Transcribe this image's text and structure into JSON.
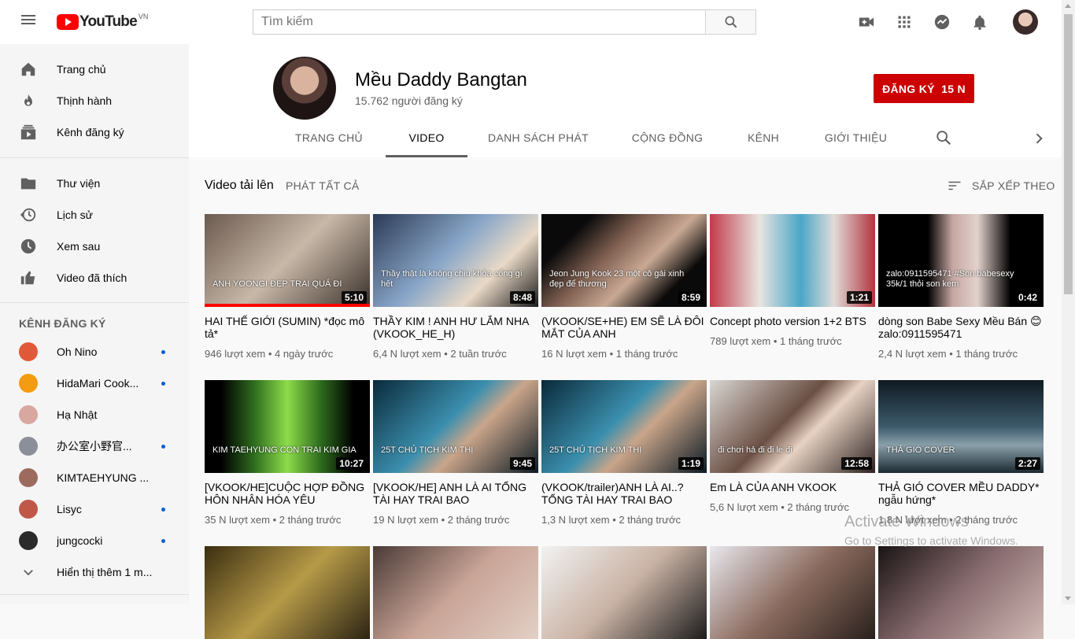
{
  "header": {
    "logo_text": "YouTube",
    "logo_country": "VN",
    "search_placeholder": "Tìm kiếm",
    "icons": [
      "menu-icon",
      "search-icon",
      "video-camera-icon",
      "apps-icon",
      "messages-icon",
      "bell-icon"
    ]
  },
  "sidebar": {
    "main_items": [
      {
        "label": "Trang chủ",
        "icon": "home-icon"
      },
      {
        "label": "Thịnh hành",
        "icon": "fire-icon"
      },
      {
        "label": "Kênh đăng ký",
        "icon": "subscriptions-icon"
      }
    ],
    "library_items": [
      {
        "label": "Thư viện",
        "icon": "folder-icon"
      },
      {
        "label": "Lịch sử",
        "icon": "history-icon"
      },
      {
        "label": "Xem sau",
        "icon": "clock-icon"
      },
      {
        "label": "Video đã thích",
        "icon": "thumbs-up-icon"
      }
    ],
    "subscriptions_heading": "KÊNH ĐĂNG KÝ",
    "subscriptions": [
      {
        "name": "Oh Nino",
        "new": true,
        "color": "#e05a3a"
      },
      {
        "name": "HidaMari Cook...",
        "new": true,
        "color": "#f39c12"
      },
      {
        "name": "Hạ Nhật",
        "new": false,
        "color": "#d8a7a0"
      },
      {
        "name": "办公室小野官...",
        "new": true,
        "color": "#8a8f99"
      },
      {
        "name": "KIMTAEHYUNG ...",
        "new": false,
        "color": "#9c6b5e"
      },
      {
        "name": "Lisyc",
        "new": true,
        "color": "#c0584a"
      },
      {
        "name": "jungcocki",
        "new": true,
        "color": "#2b2b2b"
      }
    ],
    "show_more": "Hiển thị thêm 1 m..."
  },
  "channel": {
    "name": "Mều Daddy Bangtan",
    "subscribers": "15.762 người đăng ký",
    "subscribe_label": "ĐĂNG KÝ",
    "subscribe_count": "15 N",
    "tabs": [
      "TRANG CHỦ",
      "VIDEO",
      "DANH SÁCH PHÁT",
      "CỘNG ĐỒNG",
      "KÊNH",
      "GIỚI THIỆU"
    ],
    "active_tab": "VIDEO"
  },
  "content": {
    "section_title": "Video tải lên",
    "play_all": "PHÁT TẤT CẢ",
    "sort_by": "SẮP XẾP THEO",
    "videos": [
      {
        "title": "HAI THẾ GIỚI (SUMIN) *đọc mô tả*",
        "views": "946 lượt xem",
        "age": "4 ngày trước",
        "duration": "5:10",
        "caption": "ANH YOONGI ĐẸP TRAI QUÁ ĐI",
        "progress": 1.0,
        "bg": "linear-gradient(135deg,#6b5a4e,#c8b8a8 50%,#3a302a)"
      },
      {
        "title": "THẦY KIM ! ANH HƯ LẮM NHA (VKOOK_HE_H)",
        "views": "6,4 N lượt xem",
        "age": "2 tuần trước",
        "duration": "8:48",
        "caption": "Thầy thật là không chịu khỏa cổng gì hết",
        "progress": 0,
        "bg": "linear-gradient(135deg,#2b3a55,#8aa7c9 45%,#e9d9c6 70%,#1a1a1a)"
      },
      {
        "title": "(VKOOK/SE+HE) EM SẼ LÀ ĐÔI MẮT CỦA ANH",
        "views": "16 N lượt xem",
        "age": "1 tháng trước",
        "duration": "8:59",
        "caption": "Jeon Jung Kook 23 một cô gái xinh đẹp để thương",
        "progress": 0,
        "bg": "linear-gradient(135deg,#0a0a0a 0 20%,#7a5b4d 40%,#c9a994 60%,#0a0a0a 80%)"
      },
      {
        "title": "Concept photo version 1+2 BTS",
        "views": "789 lượt xem",
        "age": "1 tháng trước",
        "duration": "1:21",
        "caption": "",
        "progress": 0,
        "bg": "linear-gradient(90deg,#c23a4a,#e9e4e0 30%,#4aa6c7 55%,#e0dcd8 75%,#b2343f)"
      },
      {
        "title": "dòng son Babe Sexy Mều Bán 😊zalo:0911595471",
        "views": "2,4 N lượt xem",
        "age": "1 tháng trước",
        "duration": "0:42",
        "caption": "zalo:0911595471 #Son babesexy 35k/1 thỏi son kem",
        "progress": 0,
        "bg": "linear-gradient(90deg,#000 0 30%,#c6a7a2 45%,#e3d2cc 60%,#000 80%)"
      },
      {
        "title": "[VKOOK/HE]CUỘC HỢP ĐỒNG HÔN NHÂN HÓA YÊU",
        "views": "35 N lượt xem",
        "age": "2 tháng trước",
        "duration": "10:27",
        "caption": "KIM TAEHYUNG CON TRAI KIM GIA",
        "progress": 0,
        "bg": "linear-gradient(90deg,#000 0 10%,#2e6d1e 30%,#8ddc4a 50%,#2e6d1e 70%,#000 90%)"
      },
      {
        "title": "[VKOOK/HE] ANH LÀ AI TỔNG TÀI HAY TRAI BAO",
        "views": "19 N lượt xem",
        "age": "2 tháng trước",
        "duration": "9:45",
        "caption": "25T CHỦ TỊCH KIM THỊ",
        "progress": 0,
        "bg": "linear-gradient(135deg,#0a2a3a,#3b8fae 45%,#c9a58a 60%,#0b1a24)"
      },
      {
        "title": "(VKOOK/trailer)ANH LÀ AI..? TỔNG TÀI HAY TRAI BAO",
        "views": "1,3 N lượt xem",
        "age": "2 tháng trước",
        "duration": "1:19",
        "caption": "25T CHỦ TỊCH KIM THỊ",
        "progress": 0,
        "bg": "linear-gradient(135deg,#0a2a3a,#3b8fae 45%,#c9a58a 60%,#0b1a24)"
      },
      {
        "title": "Em LÀ CỦA ANH VKOOK",
        "views": "5,6 N lượt xem",
        "age": "2 tháng trước",
        "duration": "12:58",
        "caption": "đi chơi hả đi đi le đi",
        "progress": 0,
        "bg": "linear-gradient(135deg,#d9d6d2,#6b4f44 45%,#e7d2c3 60%,#2c2220)"
      },
      {
        "title": "THẢ GIÓ COVER MỀU DADDY* ngẫu hứng*",
        "views": "1,8 N lượt xem",
        "age": "2 tháng trước",
        "duration": "2:27",
        "caption": "THẢ GIÓ COVER",
        "progress": 0,
        "bg": "linear-gradient(180deg,#0e1a22,#3c5a6a 50%,#8aa0aa 70%,#1c2a32)"
      },
      {
        "title": "",
        "views": "",
        "age": "",
        "duration": "",
        "caption": "",
        "progress": 0,
        "bg": "linear-gradient(135deg,#3a2e10,#b79a48 50%,#2a2414)"
      },
      {
        "title": "",
        "views": "",
        "age": "",
        "duration": "",
        "caption": "",
        "progress": 0,
        "bg": "linear-gradient(135deg,#4a3a36,#c9a497 50%,#e3d0c5)"
      },
      {
        "title": "",
        "views": "",
        "age": "",
        "duration": "",
        "caption": "",
        "progress": 0,
        "bg": "linear-gradient(135deg,#f2f2f2,#c9b2a4 50%,#1c1c1c)"
      },
      {
        "title": "",
        "views": "",
        "age": "",
        "duration": "",
        "caption": "",
        "progress": 0,
        "bg": "linear-gradient(135deg,#e8e8ee,#8a6a5e 50%,#2a201c)"
      },
      {
        "title": "",
        "views": "",
        "age": "",
        "duration": "",
        "caption": "",
        "progress": 0,
        "bg": "linear-gradient(135deg,#1a1414,#8a6d70 50%,#d0b9b4)"
      }
    ]
  },
  "watermark": {
    "line1": "Activate Windows",
    "line2": "Go to Settings to activate Windows."
  }
}
